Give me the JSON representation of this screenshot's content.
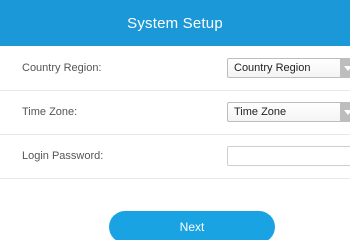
{
  "header": {
    "title": "System Setup"
  },
  "form": {
    "country_region": {
      "label": "Country Region:",
      "selected": "Country Region"
    },
    "time_zone": {
      "label": "Time Zone:",
      "selected": "Time Zone"
    },
    "login_password": {
      "label": "Login Password:",
      "value": "",
      "placeholder": ""
    }
  },
  "actions": {
    "next_label": "Next"
  },
  "colors": {
    "accent": "#1a98d8",
    "button": "#1aa3e3",
    "divider": "#e8e8e8"
  },
  "icons": {
    "select_arrow": "chevron-down-icon"
  }
}
